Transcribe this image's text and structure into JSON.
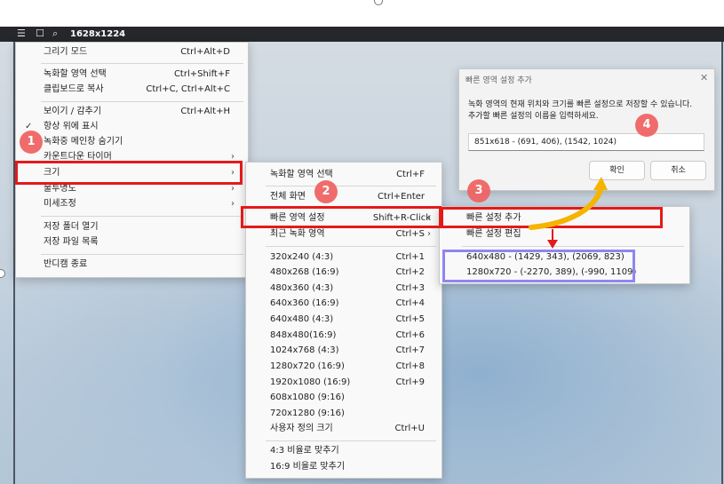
{
  "window": {
    "size_label": "1628x1224"
  },
  "main_menu": {
    "items": [
      {
        "label": "그리기 모드",
        "shortcut": "Ctrl+Alt+D"
      },
      {
        "label": "녹화할 영역 선택",
        "shortcut": "Ctrl+Shift+F"
      },
      {
        "label": "클립보드로 복사",
        "shortcut": "Ctrl+C, Ctrl+Alt+C"
      },
      {
        "label": "보이기 / 감추기",
        "shortcut": "Ctrl+Alt+H"
      },
      {
        "label": "항상 위에 표시",
        "shortcut": ""
      },
      {
        "label": "녹화중 메인창 숨기기",
        "shortcut": ""
      },
      {
        "label": "카운트다운 타이머",
        "shortcut": ""
      },
      {
        "label": "크기",
        "shortcut": ""
      },
      {
        "label": "불투명도",
        "shortcut": ""
      },
      {
        "label": "미세조정",
        "shortcut": ""
      },
      {
        "label": "저장 폴더 열기",
        "shortcut": ""
      },
      {
        "label": "저장 파일 목록",
        "shortcut": ""
      },
      {
        "label": "반디캠 종료",
        "shortcut": ""
      }
    ]
  },
  "size_menu": {
    "items": [
      {
        "label": "녹화할 영역 선택",
        "shortcut": "Ctrl+F"
      },
      {
        "label": "전체 화면",
        "shortcut": "Ctrl+Enter"
      },
      {
        "label": "빠른 영역 설정",
        "shortcut": "Shift+R-Click"
      },
      {
        "label": "최근 녹화 영역",
        "shortcut": "Ctrl+S"
      },
      {
        "label": "320x240 (4:3)",
        "shortcut": "Ctrl+1"
      },
      {
        "label": "480x268 (16:9)",
        "shortcut": "Ctrl+2"
      },
      {
        "label": "480x360 (4:3)",
        "shortcut": "Ctrl+3"
      },
      {
        "label": "640x360 (16:9)",
        "shortcut": "Ctrl+4"
      },
      {
        "label": "640x480 (4:3)",
        "shortcut": "Ctrl+5"
      },
      {
        "label": "848x480(16:9)",
        "shortcut": "Ctrl+6"
      },
      {
        "label": "1024x768 (4:3)",
        "shortcut": "Ctrl+7"
      },
      {
        "label": "1280x720 (16:9)",
        "shortcut": "Ctrl+8"
      },
      {
        "label": "1920x1080 (16:9)",
        "shortcut": "Ctrl+9"
      },
      {
        "label": "608x1080 (9:16)",
        "shortcut": ""
      },
      {
        "label": "720x1280 (9:16)",
        "shortcut": ""
      },
      {
        "label": "사용자 정의 크기",
        "shortcut": "Ctrl+U"
      },
      {
        "label": "4:3 비율로 맞추기",
        "shortcut": ""
      },
      {
        "label": "16:9 비율로 맞추기",
        "shortcut": ""
      }
    ]
  },
  "quick_menu": {
    "items": [
      {
        "label": "빠른 설정 추가"
      },
      {
        "label": "빠른 설정 편집"
      },
      {
        "label": "640x480 - (1429, 343), (2069, 823)"
      },
      {
        "label": "1280x720 - (-2270, 389), (-990, 1109)"
      }
    ]
  },
  "dialog": {
    "title": "빠른 영역 설정 추가",
    "message_line1": "녹화 영역의 현재 위치와 크기를 빠른 설정으로 저장할 수 있습니다.",
    "message_line2": "추가할 빠른 설정의 이름을 입력하세요.",
    "name_value": "851x618 - (691, 406), (1542, 1024)",
    "ok_label": "확인",
    "cancel_label": "취소"
  },
  "badges": [
    "1",
    "2",
    "3",
    "4"
  ],
  "colors": {
    "highlight_red": "#e41a1a",
    "highlight_blue": "#8f86f0",
    "badge": "#f06262",
    "arrow_yellow": "#f5b400"
  }
}
